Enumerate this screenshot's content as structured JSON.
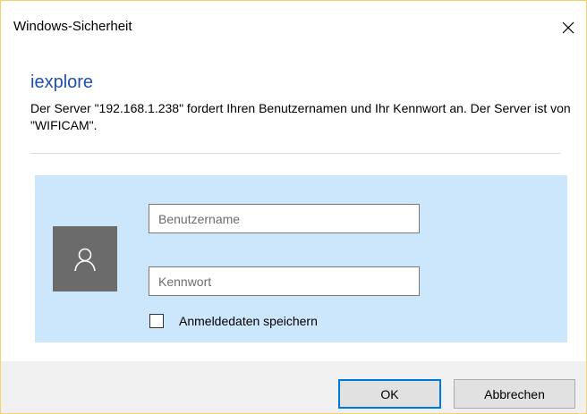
{
  "window": {
    "title": "Windows-Sicherheit"
  },
  "app_name": "iexplore",
  "message": "Der Server \"192.168.1.238\" fordert Ihren Benutzernamen und Ihr Kennwort an. Der Server ist von \"WIFICAM\".",
  "credentials": {
    "username_placeholder": "Benutzername",
    "username_value": "",
    "password_placeholder": "Kennwort",
    "password_value": "",
    "remember_label": "Anmeldedaten speichern",
    "remember_checked": false
  },
  "buttons": {
    "ok_label": "OK",
    "cancel_label": "Abbrechen"
  },
  "icons": {
    "close": "close-icon",
    "avatar": "user-icon"
  },
  "colors": {
    "accent": "#0078d7",
    "app_name": "#1f4fb5",
    "panel_background": "#cce6fb",
    "avatar_background": "#6b6b6b",
    "footer_background": "#f0f0f0"
  }
}
